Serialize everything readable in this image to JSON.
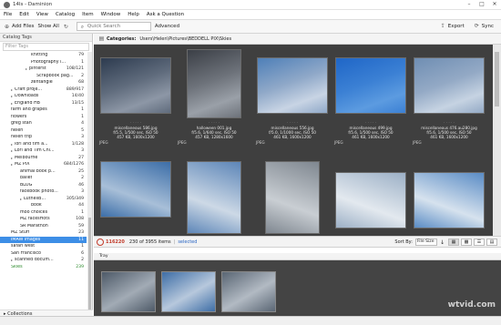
{
  "window": {
    "title": "14ls - Daminion"
  },
  "menu": [
    "File",
    "Edit",
    "View",
    "Catalog",
    "Item",
    "Window",
    "Help",
    "Ask a Question"
  ],
  "toolbar": {
    "add_files": "Add Files",
    "show_all": "Show All",
    "search_placeholder": "Quick Search",
    "advanced": "Advanced",
    "export": "Export",
    "sync": "Sync"
  },
  "sidebar": {
    "header": "Catalog Tags",
    "filter_placeholder": "Filter Tags",
    "tags": [
      {
        "name": "knitting",
        "count": "79"
      },
      {
        "name": "Photography i...",
        "count": "1"
      },
      {
        "name": "pinterst",
        "count": "108/121"
      },
      {
        "name": "Scrapbook pag...",
        "count": "2"
      },
      {
        "name": "zentangle",
        "count": "68"
      },
      {
        "name": "Craft proje...",
        "count": "889/917"
      },
      {
        "name": "Downloads",
        "count": "14/40"
      },
      {
        "name": "England HB",
        "count": "13/15"
      },
      {
        "name": "farm and grapes",
        "count": "1"
      },
      {
        "name": "flowers",
        "count": "1"
      },
      {
        "name": "greg stan",
        "count": "4"
      },
      {
        "name": "helen",
        "count": "5"
      },
      {
        "name": "helen trip",
        "count": "3"
      },
      {
        "name": "lori and tim a...",
        "count": "1/128"
      },
      {
        "name": "Lori and Tim Chi...",
        "count": "3"
      },
      {
        "name": "Melbourne",
        "count": "27"
      },
      {
        "name": "MZ PIX",
        "count": "684/1276"
      },
      {
        "name": "animal book p...",
        "count": "25"
      },
      {
        "name": "ballet",
        "count": "2"
      },
      {
        "name": "BLOG",
        "count": "46"
      },
      {
        "name": "facebook photo...",
        "count": "3"
      },
      {
        "name": "LuthellB...",
        "count": "305/349"
      },
      {
        "name": "book",
        "count": "44"
      },
      {
        "name": "moo choices",
        "count": "1"
      },
      {
        "name": "MZ facesHots",
        "count": "108"
      },
      {
        "name": "SR Marathon",
        "count": "59"
      },
      {
        "name": "MZ Stuff",
        "count": "23"
      },
      {
        "name": "IMAW images",
        "count": "11"
      },
      {
        "name": "safari west",
        "count": "1"
      },
      {
        "name": "San Francisco",
        "count": "6"
      },
      {
        "name": "scanned docum...",
        "count": "2"
      },
      {
        "name": "Skies",
        "count": "239"
      }
    ],
    "collections": "Collections"
  },
  "category_bar": {
    "label": "Categories:",
    "path": "Users\\Helen\\Pictures\\BEDDELL PIX\\Skies"
  },
  "grid": {
    "items": [
      {
        "file": "miscellaneous 586.jpg",
        "exif": "f/5.5, 1/500 sec, ISO 50",
        "size": "457 KB, 1600x1200",
        "tone": [
          "#2d3b4f",
          "#8d97a6",
          "#5f6b7c"
        ]
      },
      {
        "file": "halloween 001.jpg",
        "exif": "f/5.6, 1/640 sec, ISO 50",
        "size": "457 KB, 1280x1600",
        "tone": [
          "#3b3f46",
          "#9aa0a8",
          "#6d727a"
        ]
      },
      {
        "file": "miscellaneous 556.jpg",
        "exif": "f/5.0, 1/1000 sec, ISO 50",
        "size": "461 KB, 1600x1200",
        "tone": [
          "#4e7fb8",
          "#c8d4e4",
          "#8fa8c8"
        ]
      },
      {
        "file": "miscellaneous 499.jpg",
        "exif": "f/5.6, 1/500 sec, ISO 50",
        "size": "461 KB, 1600x1200",
        "tone": [
          "#1f66c7",
          "#5c9be0",
          "#3b80d4"
        ]
      },
      {
        "file": "miscellaneous 476.au280.jpg",
        "exif": "f/5.6, 1/500 sec, ISO 50",
        "size": "461 KB, 1600x1200",
        "tone": [
          "#6f8eb3",
          "#c6d3e2",
          "#93a9c5"
        ]
      }
    ],
    "row2_label": "JPEG",
    "row2_tones": [
      [
        "#3c6ea8",
        "#a8bfd8"
      ],
      [
        "#5d86b8",
        "#cdd9e6"
      ],
      [
        "#7f8790",
        "#c9ced3"
      ],
      [
        "#9cb0c6",
        "#e3e9ef"
      ],
      [
        "#5a8cc5",
        "#d6e2ee"
      ]
    ]
  },
  "status": {
    "badge": "116220",
    "items_text": "230 of 3955 items",
    "selected": "selected",
    "sort_label": "Sort By:",
    "sort_value": "File Size"
  },
  "tray": {
    "label": "Tray",
    "items": [
      [
        "#4e5a68",
        "#a2abb5"
      ],
      [
        "#3e6ea6",
        "#b7c8dc"
      ],
      [
        "#5a6674",
        "#b2bac3"
      ]
    ]
  },
  "watermark": "wtvid.com"
}
